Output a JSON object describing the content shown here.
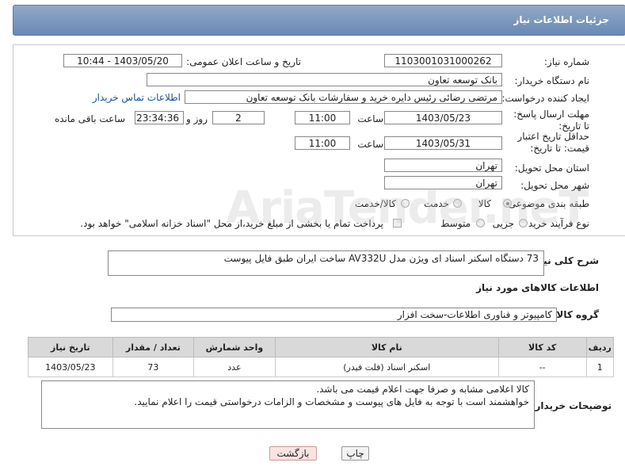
{
  "header": {
    "title": "جزئیات اطلاعات نیاز"
  },
  "form": {
    "need_number_label": "شماره نیاز:",
    "need_number": "1103001031000262",
    "announce_label": "تاریخ و ساعت اعلان عمومی:",
    "announce_value": "1403/05/20 - 10:44",
    "buyer_org_label": "نام دستگاه خریدار:",
    "buyer_org": "بانک توسعه تعاون",
    "requester_label": "ایجاد کننده درخواست:",
    "requester": "مرتضی رضائی رئیس دایره خرید و سفارشات بانک توسعه تعاون",
    "contact_link": "اطلاعات تماس خریدار",
    "reply_deadline_label": "مهلت ارسال پاسخ: تا تاریخ:",
    "reply_date": "1403/05/23",
    "time_label": "ساعت",
    "reply_time": "11:00",
    "days_value": "2",
    "days_label": "روز و",
    "remaining_time": "23:34:36",
    "remaining_label": "ساعت باقی مانده",
    "price_deadline_label": "حداقل تاریخ اعتبار قیمت: تا تاریخ:",
    "price_date": "1403/05/31",
    "price_time": "11:00",
    "province_label": "استان محل تحویل:",
    "province": "تهران",
    "city_label": "شهر محل تحویل:",
    "city": "تهران",
    "category_label": "طبقه بندی موضوعی:",
    "category_options": [
      "کالا",
      "خدمت",
      "کالا/خدمت"
    ],
    "process_label": "نوع فرآیند خرید :",
    "process_options": [
      "جزیی",
      "متوسط"
    ],
    "payment_note": "پرداخت تمام یا بخشی از مبلغ خرید،از محل \"اسناد خزانه اسلامی\" خواهد بود."
  },
  "description": {
    "label": "شرح کلی نیاز:",
    "text": "73 دستگاه اسکنر اسناد ای ویژن مدل AV332U ساخت ایران طبق فایل پیوست"
  },
  "goods_section": {
    "title": "اطلاعات کالاهای مورد نیاز",
    "group_label": "گروه کالا:",
    "group_value": "کامپیوتر و فناوری اطلاعات-سخت افزار"
  },
  "table": {
    "headers": [
      "ردیف",
      "کد کالا",
      "نام کالا",
      "واحد شمارش",
      "تعداد / مقدار",
      "تاریخ نیاز"
    ],
    "rows": [
      [
        "1",
        "--",
        "اسکنر اسناد (فلت فیدر)",
        "عدد",
        "73",
        "1403/05/23"
      ]
    ]
  },
  "buyer_notes": {
    "label": "توضیحات خریدار:",
    "line1": "کالا اعلامی مشابه و صرفا جهت اعلام قیمت می باشد.",
    "line2": "خواهشمند است با توجه به فایل های پیوست و مشخصات و الزامات درخواستی قیمت را اعلام نمایید."
  },
  "buttons": {
    "print": "چاپ",
    "back": "بازگشت"
  },
  "watermark": "AriaTender.neT"
}
